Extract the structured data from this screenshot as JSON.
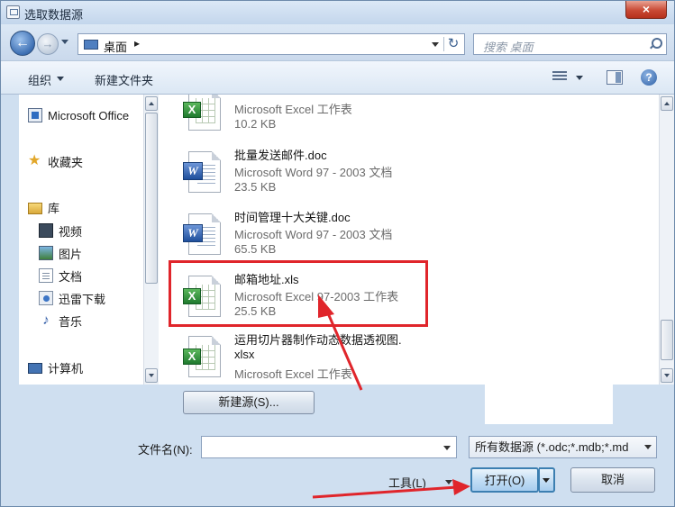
{
  "window": {
    "title": "选取数据源",
    "close_label": "×"
  },
  "address": {
    "location": "桌面",
    "separator": "▸",
    "refresh": "↻",
    "search_placeholder": "搜索 桌面"
  },
  "toolbar": {
    "organize": "组织",
    "new_folder": "新建文件夹",
    "help": "?"
  },
  "nav": {
    "office": "Microsoft Office",
    "favorites": "收藏夹",
    "libraries": "库",
    "videos": "视频",
    "pictures": "图片",
    "documents": "文档",
    "thunder": "迅雷下载",
    "music": "音乐",
    "computer": "计算机"
  },
  "files": [
    {
      "name": "",
      "type": "Microsoft Excel 工作表",
      "size": "10.2 KB",
      "icon": "excel-file-icon"
    },
    {
      "name": "批量发送邮件.doc",
      "type": "Microsoft Word 97 - 2003 文档",
      "size": "23.5 KB",
      "icon": "word-file-icon"
    },
    {
      "name": "时间管理十大关键.doc",
      "type": "Microsoft Word 97 - 2003 文档",
      "size": "65.5 KB",
      "icon": "word-file-icon"
    },
    {
      "name": "邮箱地址.xls",
      "type": "Microsoft Excel 97-2003 工作表",
      "size": "25.5 KB",
      "icon": "excel-file-icon"
    },
    {
      "name": "运用切片器制作动态数据透视图.",
      "name2": "xlsx",
      "type": "Microsoft Excel 工作表",
      "icon": "excel-file-icon"
    }
  ],
  "bottom": {
    "new_source_button": "新建源(S)...",
    "filename_label": "文件名(N):",
    "filename_value": "",
    "filetype_value": "所有数据源 (*.odc;*.mdb;*.md",
    "tools_label": "工具(L)",
    "open_button": "打开(O)",
    "cancel_button": "取消"
  },
  "colors": {
    "annotation": "#e0252b",
    "accent": "#3c7fb1"
  }
}
